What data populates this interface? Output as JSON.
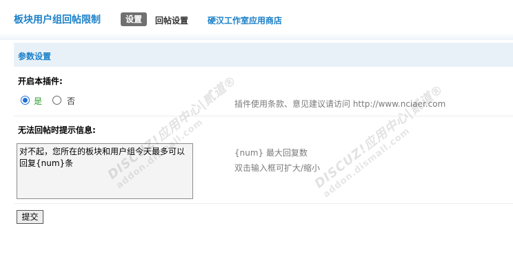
{
  "header": {
    "title": "板块用户组回帖限制",
    "tabs": [
      {
        "label": "设置",
        "active": true
      },
      {
        "label": "回帖设置",
        "active": false
      },
      {
        "label": "硬汉工作室应用商店",
        "active": false
      }
    ]
  },
  "section": {
    "title": "参数设置"
  },
  "enable_plugin": {
    "label": "开启本插件:",
    "options": [
      {
        "label": "是",
        "selected": true
      },
      {
        "label": "否",
        "selected": false
      }
    ],
    "tip": "插件使用条款、意见建议请访问 http://www.nciaer.com"
  },
  "message": {
    "label": "无法回帖时提示信息:",
    "value": "对不起，您所在的板块和用户组今天最多可以回复{num}条",
    "tips": [
      "{num} 最大回复数",
      "双击输入框可扩大/缩小"
    ]
  },
  "submit_label": "提交",
  "watermark": {
    "line1": "DISCUZ!应用中心|贰道®",
    "line2": "addon.dismall.com"
  },
  "colors": {
    "accent": "#1b80c8",
    "tab_active_bg": "#707070",
    "section_bg": "#e9f1f8",
    "yes_option": "#2a9c2a",
    "tip_text": "#7a7a7a"
  }
}
